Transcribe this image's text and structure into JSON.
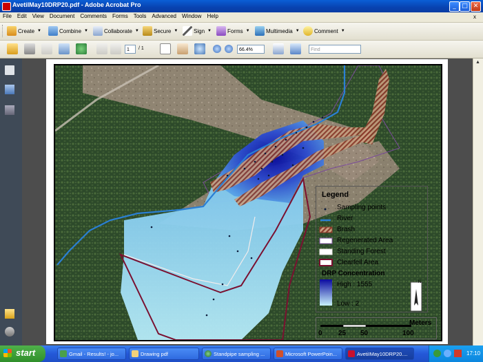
{
  "window": {
    "title": "AvetiIMay10DRP20.pdf - Adobe Acrobat Pro",
    "minimize": "_",
    "maximize": "□",
    "close": "✕"
  },
  "menu": {
    "items": [
      "File",
      "Edit",
      "View",
      "Document",
      "Comments",
      "Forms",
      "Tools",
      "Advanced",
      "Window",
      "Help"
    ],
    "doc_close": "x"
  },
  "toolbar1": {
    "create": "Create",
    "combine": "Combine",
    "collaborate": "Collaborate",
    "secure": "Secure",
    "sign": "Sign",
    "forms": "Forms",
    "multimedia": "Multimedia",
    "comment": "Comment"
  },
  "toolbar2": {
    "page_current": "1",
    "page_total": "/ 1",
    "zoom": "66.4%",
    "find_placeholder": "Find"
  },
  "map": {
    "legend_title": "Legend",
    "legend_items": {
      "sampling": "Sampling points",
      "river": "River",
      "brash": "Brash",
      "regenerated": "Regenerated Area",
      "standing": "Standing Forest",
      "clearfell": "Clearfell Area"
    },
    "drp_title": "DRP Concentration",
    "drp_high": "High : 1555",
    "drp_low": "Low : 2",
    "north": "N",
    "scale_units": "Meters",
    "scale_ticks": [
      "0",
      "25",
      "50",
      "100"
    ]
  },
  "taskbar": {
    "start": "start",
    "tasks": [
      "Gmail - Results! - jo...",
      "Drawing pdf",
      "Standpipe sampling ...",
      "Microsoft PowerPoin...",
      "AvetiIMay10DRP20...."
    ],
    "clock": "17:10"
  },
  "colors": {
    "title_bar": "#0842b0",
    "taskbar": "#2458d8",
    "river": "#2a7fd4",
    "brash": "#8b3a2a",
    "clearfell": "#7a1030",
    "regenerated": "#7a4a9a",
    "drp_high": "#1a1ab0",
    "drp_low": "#a8e4f6"
  }
}
